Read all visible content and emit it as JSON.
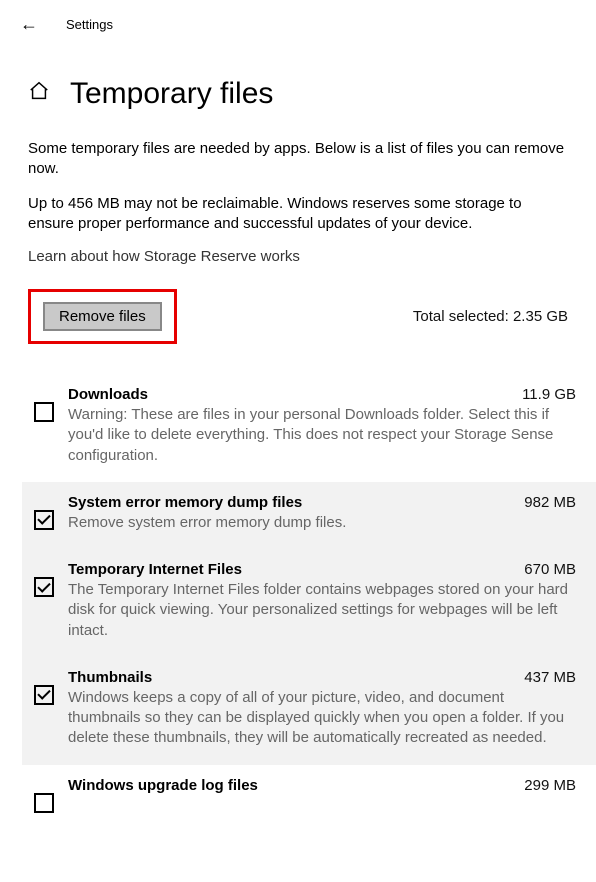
{
  "header": {
    "title": "Settings"
  },
  "page": {
    "title": "Temporary files",
    "desc1": "Some temporary files are needed by apps. Below is a list of files you can remove now.",
    "desc2": "Up to 456 MB may not be reclaimable. Windows reserves some storage to ensure proper performance and successful updates of your device.",
    "link": "Learn about how Storage Reserve works",
    "remove_label": "Remove files",
    "total_label": "Total selected: 2.35 GB"
  },
  "items": [
    {
      "name": "Downloads",
      "size": "11.9 GB",
      "desc": "Warning: These are files in your personal Downloads folder. Select this if you'd like to delete everything. This does not respect your Storage Sense configuration.",
      "checked": false
    },
    {
      "name": "System error memory dump files",
      "size": "982 MB",
      "desc": "Remove system error memory dump files.",
      "checked": true
    },
    {
      "name": "Temporary Internet Files",
      "size": "670 MB",
      "desc": "The Temporary Internet Files folder contains webpages stored on your hard disk for quick viewing. Your personalized settings for webpages will be left intact.",
      "checked": true
    },
    {
      "name": "Thumbnails",
      "size": "437 MB",
      "desc": "Windows keeps a copy of all of your picture, video, and document thumbnails so they can be displayed quickly when you open a folder. If you delete these thumbnails, they will be automatically recreated as needed.",
      "checked": true
    },
    {
      "name": "Windows upgrade log files",
      "size": "299 MB",
      "desc": "",
      "checked": false
    }
  ]
}
